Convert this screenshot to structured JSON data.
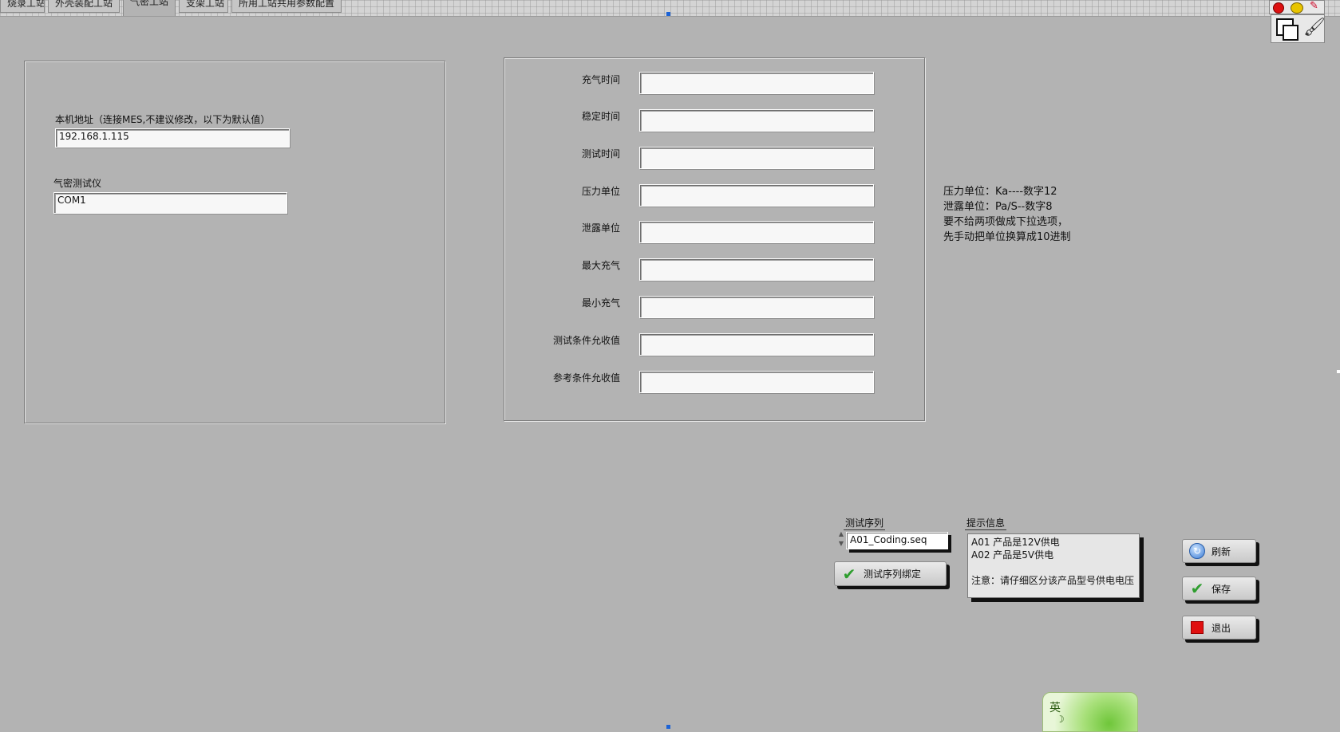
{
  "tabs": [
    "烧录工站",
    "外壳装配工站",
    "气密工站",
    "支架工站",
    "所用工站共用参数配置"
  ],
  "left_panel": {
    "ip_label": "本机地址（连接MES,不建议修改，以下为默认值）",
    "ip_value": "192.168.1.115",
    "port_label": "气密测试仪",
    "port_value": "COM1"
  },
  "params": [
    {
      "label": "充气时间",
      "value": ""
    },
    {
      "label": "稳定时间",
      "value": ""
    },
    {
      "label": "测试时间",
      "value": ""
    },
    {
      "label": "压力单位",
      "value": ""
    },
    {
      "label": "泄露单位",
      "value": ""
    },
    {
      "label": "最大充气",
      "value": ""
    },
    {
      "label": "最小充气",
      "value": ""
    },
    {
      "label": "测试条件允收值",
      "value": ""
    },
    {
      "label": "参考条件允收值",
      "value": ""
    }
  ],
  "notes": [
    "压力单位：Ka----数字12",
    "泄露单位：Pa/S--数字8",
    "要不给两项做成下拉选项，",
    "先手动把单位换算成10进制"
  ],
  "sequence": {
    "label": "测试序列",
    "value": "A01_Coding.seq",
    "bind_button": "测试序列绑定"
  },
  "hint": {
    "label": "提示信息",
    "text": "A01 产品是12V供电\nA02 产品是5V供电\n\n注意：请仔细区分该产品型号供电电压"
  },
  "buttons": {
    "refresh": "刷新",
    "save": "保存",
    "exit": "退出"
  },
  "ime": {
    "mode_char": "英"
  },
  "colors": {
    "background": "#b3b3b3",
    "field": "#f7f7f7",
    "stop": "#e01010",
    "check": "#2f9e2f"
  }
}
